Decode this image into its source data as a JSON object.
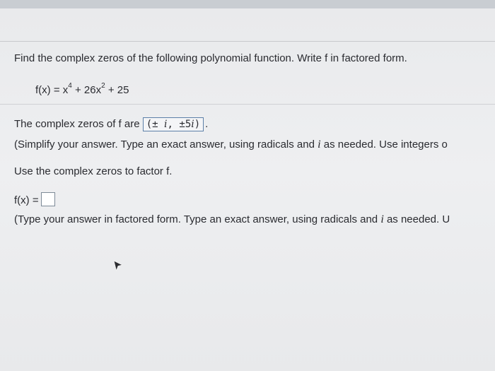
{
  "question": {
    "prompt": "Find the complex zeros of the following polynomial function. Write f in factored form."
  },
  "function": {
    "lhs": "f(x) = x",
    "exp1": "4",
    "mid": " + 26x",
    "exp2": "2",
    "rhs": " + 25"
  },
  "zeros": {
    "label": "The complex zeros of f are",
    "answer_open": "(± ",
    "answer_i1": "i",
    "answer_mid": ", ±5",
    "answer_i2": "i",
    "answer_close": ")",
    "period": "."
  },
  "hint1": {
    "text_a": "(Simplify your answer. Type an exact answer, using radicals and ",
    "i": "i",
    "text_b": " as needed. Use integers o"
  },
  "factor": {
    "prompt": "Use the complex zeros to factor f.",
    "fx_label": "f(x) ="
  },
  "hint2": {
    "text_a": "(Type your answer in factored form. Type an exact answer, using radicals and ",
    "i": "i",
    "text_b": " as needed. U"
  }
}
